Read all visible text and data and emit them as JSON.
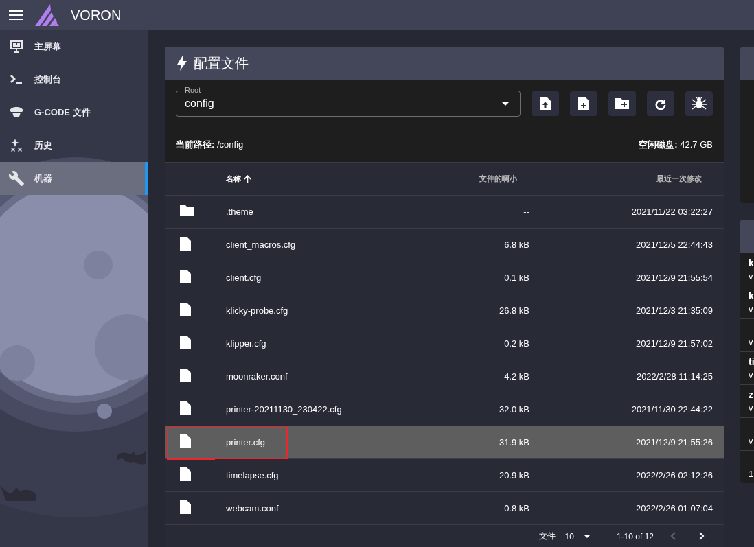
{
  "app_bar": {
    "title": "VORON"
  },
  "sidebar": {
    "items": [
      {
        "label": "主屏幕",
        "selected": false
      },
      {
        "label": "控制台",
        "selected": false
      },
      {
        "label": "G-CODE 文件",
        "selected": false
      },
      {
        "label": "历史",
        "selected": false
      },
      {
        "label": "机器",
        "selected": true
      }
    ]
  },
  "config_panel": {
    "title": "配置文件",
    "root_select": {
      "label": "Root",
      "value": "config"
    },
    "path": "**当前路径:** /config",
    "disk": "**空闲磁盘:** 42.7 GB",
    "columns": [
      {
        "label": "名称",
        "sorted": true
      },
      {
        "label": "文件的啊小",
        "sorted": false
      },
      {
        "label": "最近一次修改",
        "sorted": false
      }
    ],
    "rows": [
      {
        "kind": "folder",
        "name": ".theme",
        "size": "--",
        "modified": "2021/11/22 03:22:27",
        "selected": false,
        "highlighted": false
      },
      {
        "kind": "file",
        "name": "client_macros.cfg",
        "size": "6.8 kB",
        "modified": "2021/12/5 22:44:43",
        "selected": false,
        "highlighted": false
      },
      {
        "kind": "file",
        "name": "client.cfg",
        "size": "0.1 kB",
        "modified": "2021/12/9 21:55:54",
        "selected": false,
        "highlighted": false
      },
      {
        "kind": "file",
        "name": "klicky-probe.cfg",
        "size": "26.8 kB",
        "modified": "2021/12/3 21:35:09",
        "selected": false,
        "highlighted": false
      },
      {
        "kind": "file",
        "name": "klipper.cfg",
        "size": "0.2 kB",
        "modified": "2021/12/9 21:57:02",
        "selected": false,
        "highlighted": false
      },
      {
        "kind": "file",
        "name": "moonraker.conf",
        "size": "4.2 kB",
        "modified": "2022/2/28 11:14:25",
        "selected": false,
        "highlighted": false
      },
      {
        "kind": "file",
        "name": "printer-20211130_230422.cfg",
        "size": "32.0 kB",
        "modified": "2021/11/30 22:44:22",
        "selected": false,
        "highlighted": false
      },
      {
        "kind": "file",
        "name": "printer.cfg",
        "size": "31.9 kB",
        "modified": "2021/12/9 21:55:26",
        "selected": true,
        "highlighted": true
      },
      {
        "kind": "file",
        "name": "timelapse.cfg",
        "size": "20.9 kB",
        "modified": "2022/2/26 02:12:26",
        "selected": false,
        "highlighted": false
      },
      {
        "kind": "file",
        "name": "webcam.conf",
        "size": "0.8 kB",
        "modified": "2022/2/26 01:07:04",
        "selected": false,
        "highlighted": false
      }
    ],
    "footer": {
      "label": "文件",
      "per_page": "10",
      "range": "1-10 of 12",
      "prev_disabled": true,
      "next_disabled": false
    }
  },
  "side_panel": {
    "rows": [
      {
        "title": "k",
        "subtitle": "v"
      },
      {
        "title": "k",
        "subtitle": "v"
      },
      {
        "subtitle": "v"
      },
      {
        "title": "ti",
        "subtitle": "v"
      },
      {
        "title": "z",
        "subtitle": "v"
      },
      {
        "subtitle": "v"
      },
      {
        "subtitle": "1"
      }
    ]
  }
}
